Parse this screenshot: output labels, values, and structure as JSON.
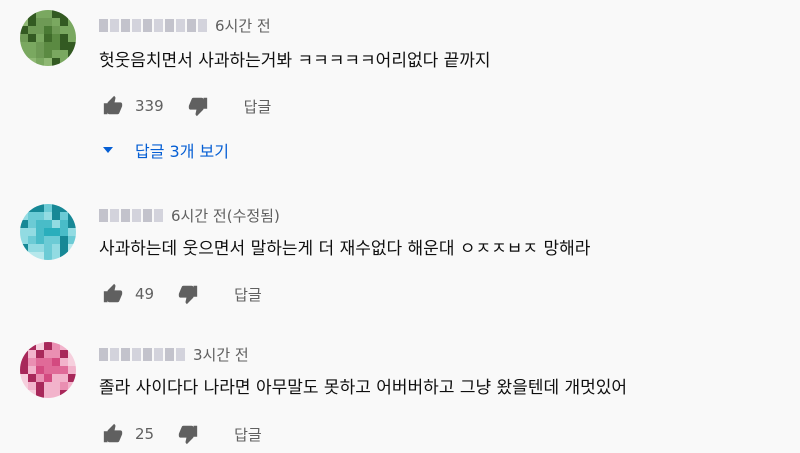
{
  "comments": [
    {
      "time": "6시간 전",
      "text": "헛웃음치면서 사과하는거봐 ㅋㅋㅋㅋㅋ어리없다 끝까지",
      "likes": "339",
      "reply_label": "답글",
      "view_replies_label": "답글 3개 보기",
      "avatar_palette": [
        "#3f6b2a",
        "#4a7a34",
        "#5b8a42",
        "#6e9a55",
        "#7aa860",
        "#335a22",
        "#8fb874"
      ]
    },
    {
      "time": "6시간 전(수정됨)",
      "text": "사과하는데 웃으면서 말하는게 더 재수없다 해운대 ㅇㅈㅈㅂㅈ 망해라",
      "likes": "49",
      "reply_label": "답글",
      "avatar_palette": [
        "#1e9aa8",
        "#2aaebc",
        "#49bcc8",
        "#6ccbd5",
        "#92dbe2",
        "#178896",
        "#b7e8ec"
      ]
    },
    {
      "time": "3시간 전",
      "text": "졸라 사이다다 나라면 아무말도 못하고 어버버하고 그냥 왔을텐데 개멋있어",
      "likes": "25",
      "reply_label": "답글",
      "avatar_palette": [
        "#c0326a",
        "#d34a80",
        "#e06a98",
        "#ea8fb2",
        "#f2b3cb",
        "#a8285a",
        "#f6cfdd"
      ]
    }
  ]
}
